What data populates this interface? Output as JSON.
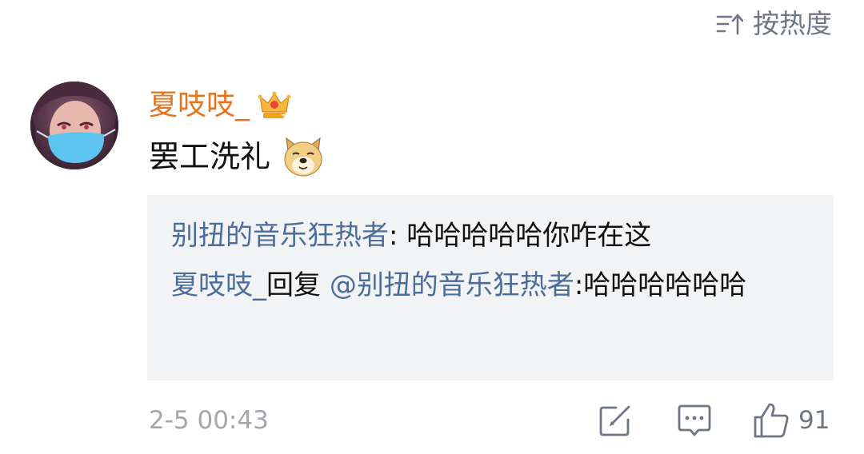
{
  "sort": {
    "label": "按热度",
    "icon": "sort-icon"
  },
  "comment": {
    "username": "夏吱吱_",
    "username_color": "#e8731e",
    "badge_icon": "crown-icon",
    "text": "罢工洗礼",
    "emoji_icon": "doge-emoji-icon",
    "timestamp": "2-5 00:43",
    "like_count": "91"
  },
  "replies": [
    {
      "author": "别扭的音乐狂热者",
      "separator": ": ",
      "text": "哈哈哈哈哈你咋在这"
    },
    {
      "author": "夏吱吱_",
      "reply_word": "回复",
      "mention": "@别扭的音乐狂热者",
      "separator": ":",
      "text": "哈哈哈哈哈哈"
    }
  ],
  "colors": {
    "link": "#4c6d9b",
    "reply_background": "#f2f3f5",
    "muted": "#a3a7ad"
  },
  "actions": {
    "share_icon": "share-icon",
    "reply_icon": "comment-icon",
    "like_icon": "thumbs-up-icon"
  }
}
